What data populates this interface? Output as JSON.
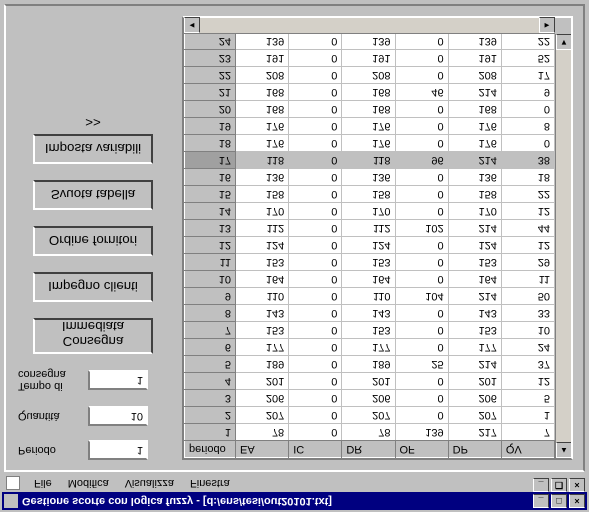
{
  "window": {
    "title": "Gestione scorte con logica fuzzy - [d:/ens/tesi/out20101.txt]"
  },
  "menu": {
    "file": "File",
    "modifica": "Modifica",
    "visualizza": "Visualizza",
    "finestra": "Finestra"
  },
  "fields": {
    "periodo_label": "Periodo",
    "periodo_value": "1",
    "quantita_label": "Quantità",
    "quantita_value": "10",
    "tempo_label": "Tempo di consegna",
    "tempo_value": "1"
  },
  "buttons": {
    "consegna": "Consegna Immediata",
    "impegno": "Impegno clienti",
    "ordine": "Ordine fornitori",
    "svuota": "Svuota tabella",
    "imposta": "Imposta variabili >>"
  },
  "grid": {
    "headers": [
      "periodo",
      "EA",
      "IC",
      "DR",
      "OF",
      "DP",
      "QV"
    ],
    "rows": [
      {
        "p": "1",
        "ea": "78",
        "ic": "0",
        "dr": "78",
        "of": "139",
        "dp": "217",
        "qv": "7"
      },
      {
        "p": "2",
        "ea": "207",
        "ic": "0",
        "dr": "207",
        "of": "0",
        "dp": "207",
        "qv": "1"
      },
      {
        "p": "3",
        "ea": "206",
        "ic": "0",
        "dr": "206",
        "of": "0",
        "dp": "206",
        "qv": "5"
      },
      {
        "p": "4",
        "ea": "201",
        "ic": "0",
        "dr": "201",
        "of": "0",
        "dp": "201",
        "qv": "12"
      },
      {
        "p": "5",
        "ea": "189",
        "ic": "0",
        "dr": "189",
        "of": "25",
        "dp": "214",
        "qv": "37"
      },
      {
        "p": "6",
        "ea": "177",
        "ic": "0",
        "dr": "177",
        "of": "0",
        "dp": "177",
        "qv": "24"
      },
      {
        "p": "7",
        "ea": "153",
        "ic": "0",
        "dr": "153",
        "of": "0",
        "dp": "153",
        "qv": "10"
      },
      {
        "p": "8",
        "ea": "143",
        "ic": "0",
        "dr": "143",
        "of": "0",
        "dp": "143",
        "qv": "33"
      },
      {
        "p": "9",
        "ea": "110",
        "ic": "0",
        "dr": "110",
        "of": "104",
        "dp": "214",
        "qv": "50"
      },
      {
        "p": "10",
        "ea": "164",
        "ic": "0",
        "dr": "164",
        "of": "0",
        "dp": "164",
        "qv": "11"
      },
      {
        "p": "11",
        "ea": "153",
        "ic": "0",
        "dr": "153",
        "of": "0",
        "dp": "153",
        "qv": "29"
      },
      {
        "p": "12",
        "ea": "124",
        "ic": "0",
        "dr": "124",
        "of": "0",
        "dp": "124",
        "qv": "12"
      },
      {
        "p": "13",
        "ea": "112",
        "ic": "0",
        "dr": "112",
        "of": "102",
        "dp": "214",
        "qv": "44"
      },
      {
        "p": "14",
        "ea": "170",
        "ic": "0",
        "dr": "170",
        "of": "0",
        "dp": "170",
        "qv": "12"
      },
      {
        "p": "15",
        "ea": "158",
        "ic": "0",
        "dr": "158",
        "of": "0",
        "dp": "158",
        "qv": "22"
      },
      {
        "p": "16",
        "ea": "136",
        "ic": "0",
        "dr": "136",
        "of": "0",
        "dp": "136",
        "qv": "18"
      },
      {
        "p": "17",
        "ea": "118",
        "ic": "0",
        "dr": "118",
        "of": "96",
        "dp": "214",
        "qv": "38"
      },
      {
        "p": "18",
        "ea": "176",
        "ic": "0",
        "dr": "176",
        "of": "0",
        "dp": "176",
        "qv": "0"
      },
      {
        "p": "19",
        "ea": "176",
        "ic": "0",
        "dr": "176",
        "of": "0",
        "dp": "176",
        "qv": "8"
      },
      {
        "p": "20",
        "ea": "168",
        "ic": "0",
        "dr": "168",
        "of": "0",
        "dp": "168",
        "qv": "0"
      },
      {
        "p": "21",
        "ea": "168",
        "ic": "0",
        "dr": "168",
        "of": "46",
        "dp": "214",
        "qv": "9"
      },
      {
        "p": "22",
        "ea": "208",
        "ic": "0",
        "dr": "208",
        "of": "0",
        "dp": "208",
        "qv": "17"
      },
      {
        "p": "23",
        "ea": "191",
        "ic": "0",
        "dr": "191",
        "of": "0",
        "dp": "191",
        "qv": "52"
      },
      {
        "p": "24",
        "ea": "139",
        "ic": "0",
        "dr": "139",
        "of": "0",
        "dp": "139",
        "qv": "22"
      }
    ],
    "selected_row": 16
  }
}
